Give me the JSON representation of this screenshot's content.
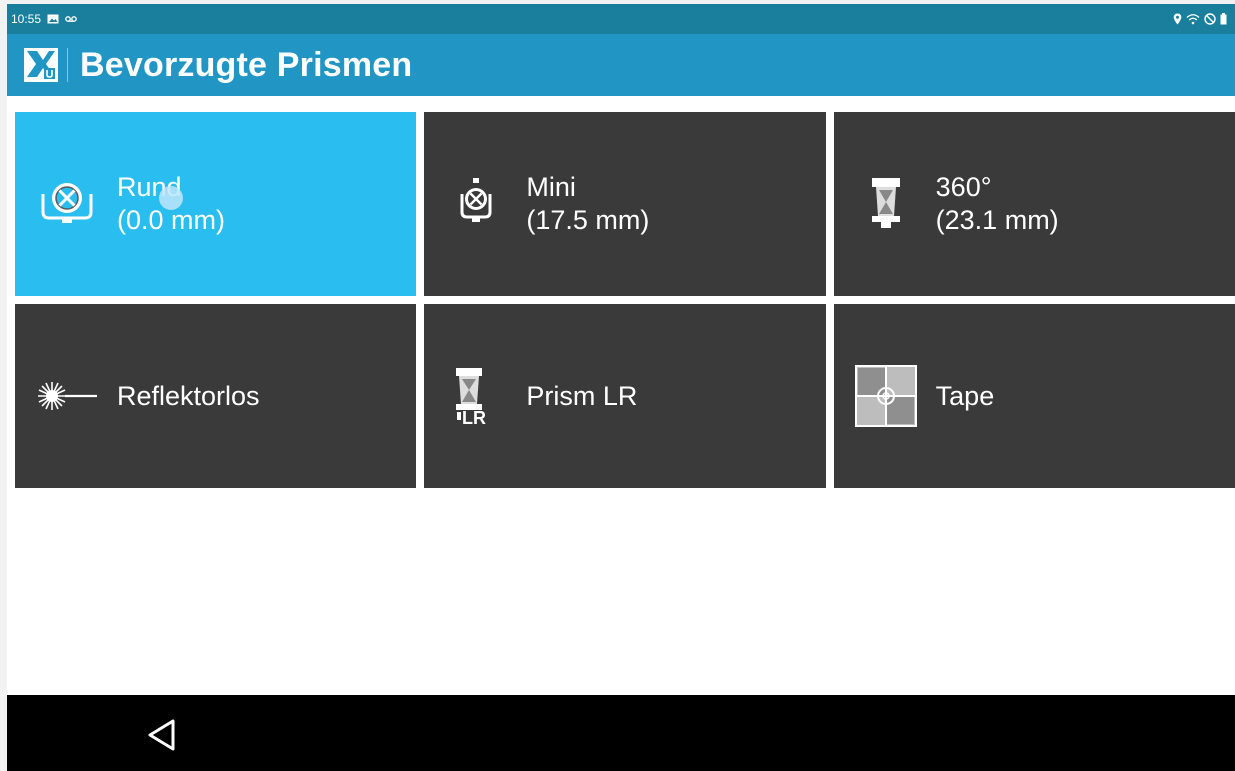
{
  "status_bar": {
    "time": "10:55",
    "left_icons": [
      "image-icon",
      "voicemail-icon"
    ],
    "right_icons": [
      "location-icon",
      "wifi-icon",
      "do-not-disturb-icon",
      "battery-icon"
    ]
  },
  "app_bar": {
    "title": "Bevorzugte Prismen",
    "logo_icon": "app-logo-icon"
  },
  "prisms": [
    {
      "name": "Rund",
      "detail": "(0.0 mm)",
      "icon": "round-prism-icon",
      "selected": true
    },
    {
      "name": "Mini",
      "detail": "(17.5 mm)",
      "icon": "mini-prism-icon",
      "selected": false
    },
    {
      "name": "360°",
      "detail": "(23.1 mm)",
      "icon": "360-prism-icon",
      "selected": false
    },
    {
      "name": "Reflektorlos",
      "detail": "",
      "icon": "reflectorless-icon",
      "selected": false
    },
    {
      "name": "Prism LR",
      "detail": "",
      "icon": "prism-lr-icon",
      "selected": false
    },
    {
      "name": "Tape",
      "detail": "",
      "icon": "tape-target-icon",
      "selected": false
    }
  ],
  "prism_lr_badge": "LR",
  "colors": {
    "status_bar": "#1a7f9c",
    "app_bar": "#2196c4",
    "tile": "#3a3a3a",
    "tile_selected": "#29bdf0",
    "nav_bar": "#000000"
  },
  "nav_bar": {
    "back_icon": "back-triangle-icon"
  }
}
